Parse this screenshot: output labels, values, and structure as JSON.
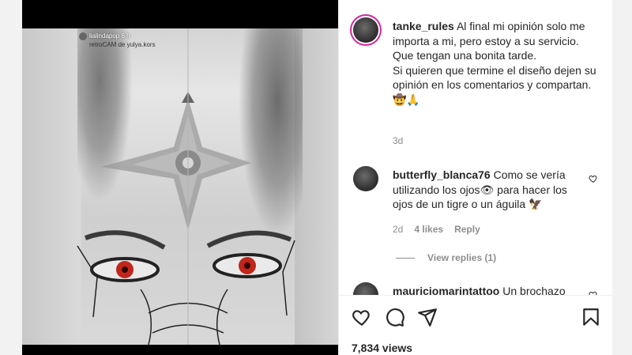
{
  "media": {
    "overlay_username": "lialindapop",
    "overlay_time": "6 h",
    "overlay_effect": "retroCAM de yulya.kors"
  },
  "caption": {
    "username": "tanke_rules",
    "lines": [
      "Al final mi opinión solo me importa a mi, pero estoy a su servicio.",
      "Que tengan una bonita tarde.",
      "Si quieren que termine el diseño dejen su opinión en los comentarios y compartan.",
      "🤠🙏"
    ],
    "time": "3d"
  },
  "comments": [
    {
      "username": "butterfly_blanca76",
      "text": "Como se vería utilizando los ojos👁 para hacer los ojos de un tigre o un águila 🦅",
      "time": "2d",
      "likes": "4 likes",
      "reply": "Reply",
      "view_replies": "View replies (1)"
    },
    {
      "username": "mauriciomarintattoo",
      "text": "Un brochazo"
    }
  ],
  "footer": {
    "views": "7,834 views"
  },
  "icons": {
    "like": "heart-icon",
    "comment": "comment-icon",
    "share": "share-icon",
    "save": "bookmark-icon"
  },
  "colors": {
    "story_ring": "#d6249f",
    "text": "#262626",
    "secondary": "#8e8e8e"
  }
}
